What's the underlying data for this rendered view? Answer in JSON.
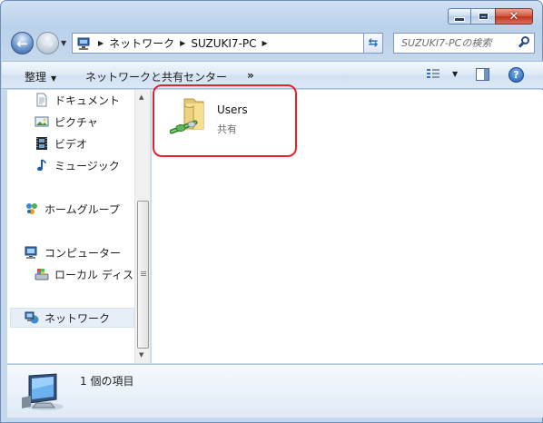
{
  "window": {
    "caption_buttons": {
      "minimize": "minimize-icon",
      "maximize": "maximize-icon",
      "close": "close-icon"
    }
  },
  "address_bar": {
    "breadcrumbs": [
      "ネットワーク",
      "SUZUKI7-PC"
    ],
    "icon": "network-computer-icon"
  },
  "search": {
    "placeholder": "SUZUKI7-PCの検索"
  },
  "command_bar": {
    "organize": "整理",
    "network_center": "ネットワークと共有センター",
    "more": "»"
  },
  "nav_pane": {
    "items": [
      {
        "label": "ドキュメント",
        "icon": "document-icon"
      },
      {
        "label": "ピクチャ",
        "icon": "picture-icon"
      },
      {
        "label": "ビデオ",
        "icon": "video-icon"
      },
      {
        "label": "ミュージック",
        "icon": "music-icon"
      },
      {
        "label": "ホームグループ",
        "icon": "homegroup-icon"
      },
      {
        "label": "コンピューター",
        "icon": "computer-icon"
      },
      {
        "label": "ローカル ディス",
        "icon": "local-disk-icon"
      },
      {
        "label": "ネットワーク",
        "icon": "network-icon",
        "selected": true
      }
    ]
  },
  "content": {
    "items": [
      {
        "name": "Users",
        "type": "共有",
        "icon": "shared-folder-icon"
      }
    ]
  },
  "details_pane": {
    "count": "1 個の項目",
    "icon": "network-computer-icon"
  },
  "colors": {
    "highlight": "#e8212b",
    "selection": "#e6eef7"
  }
}
